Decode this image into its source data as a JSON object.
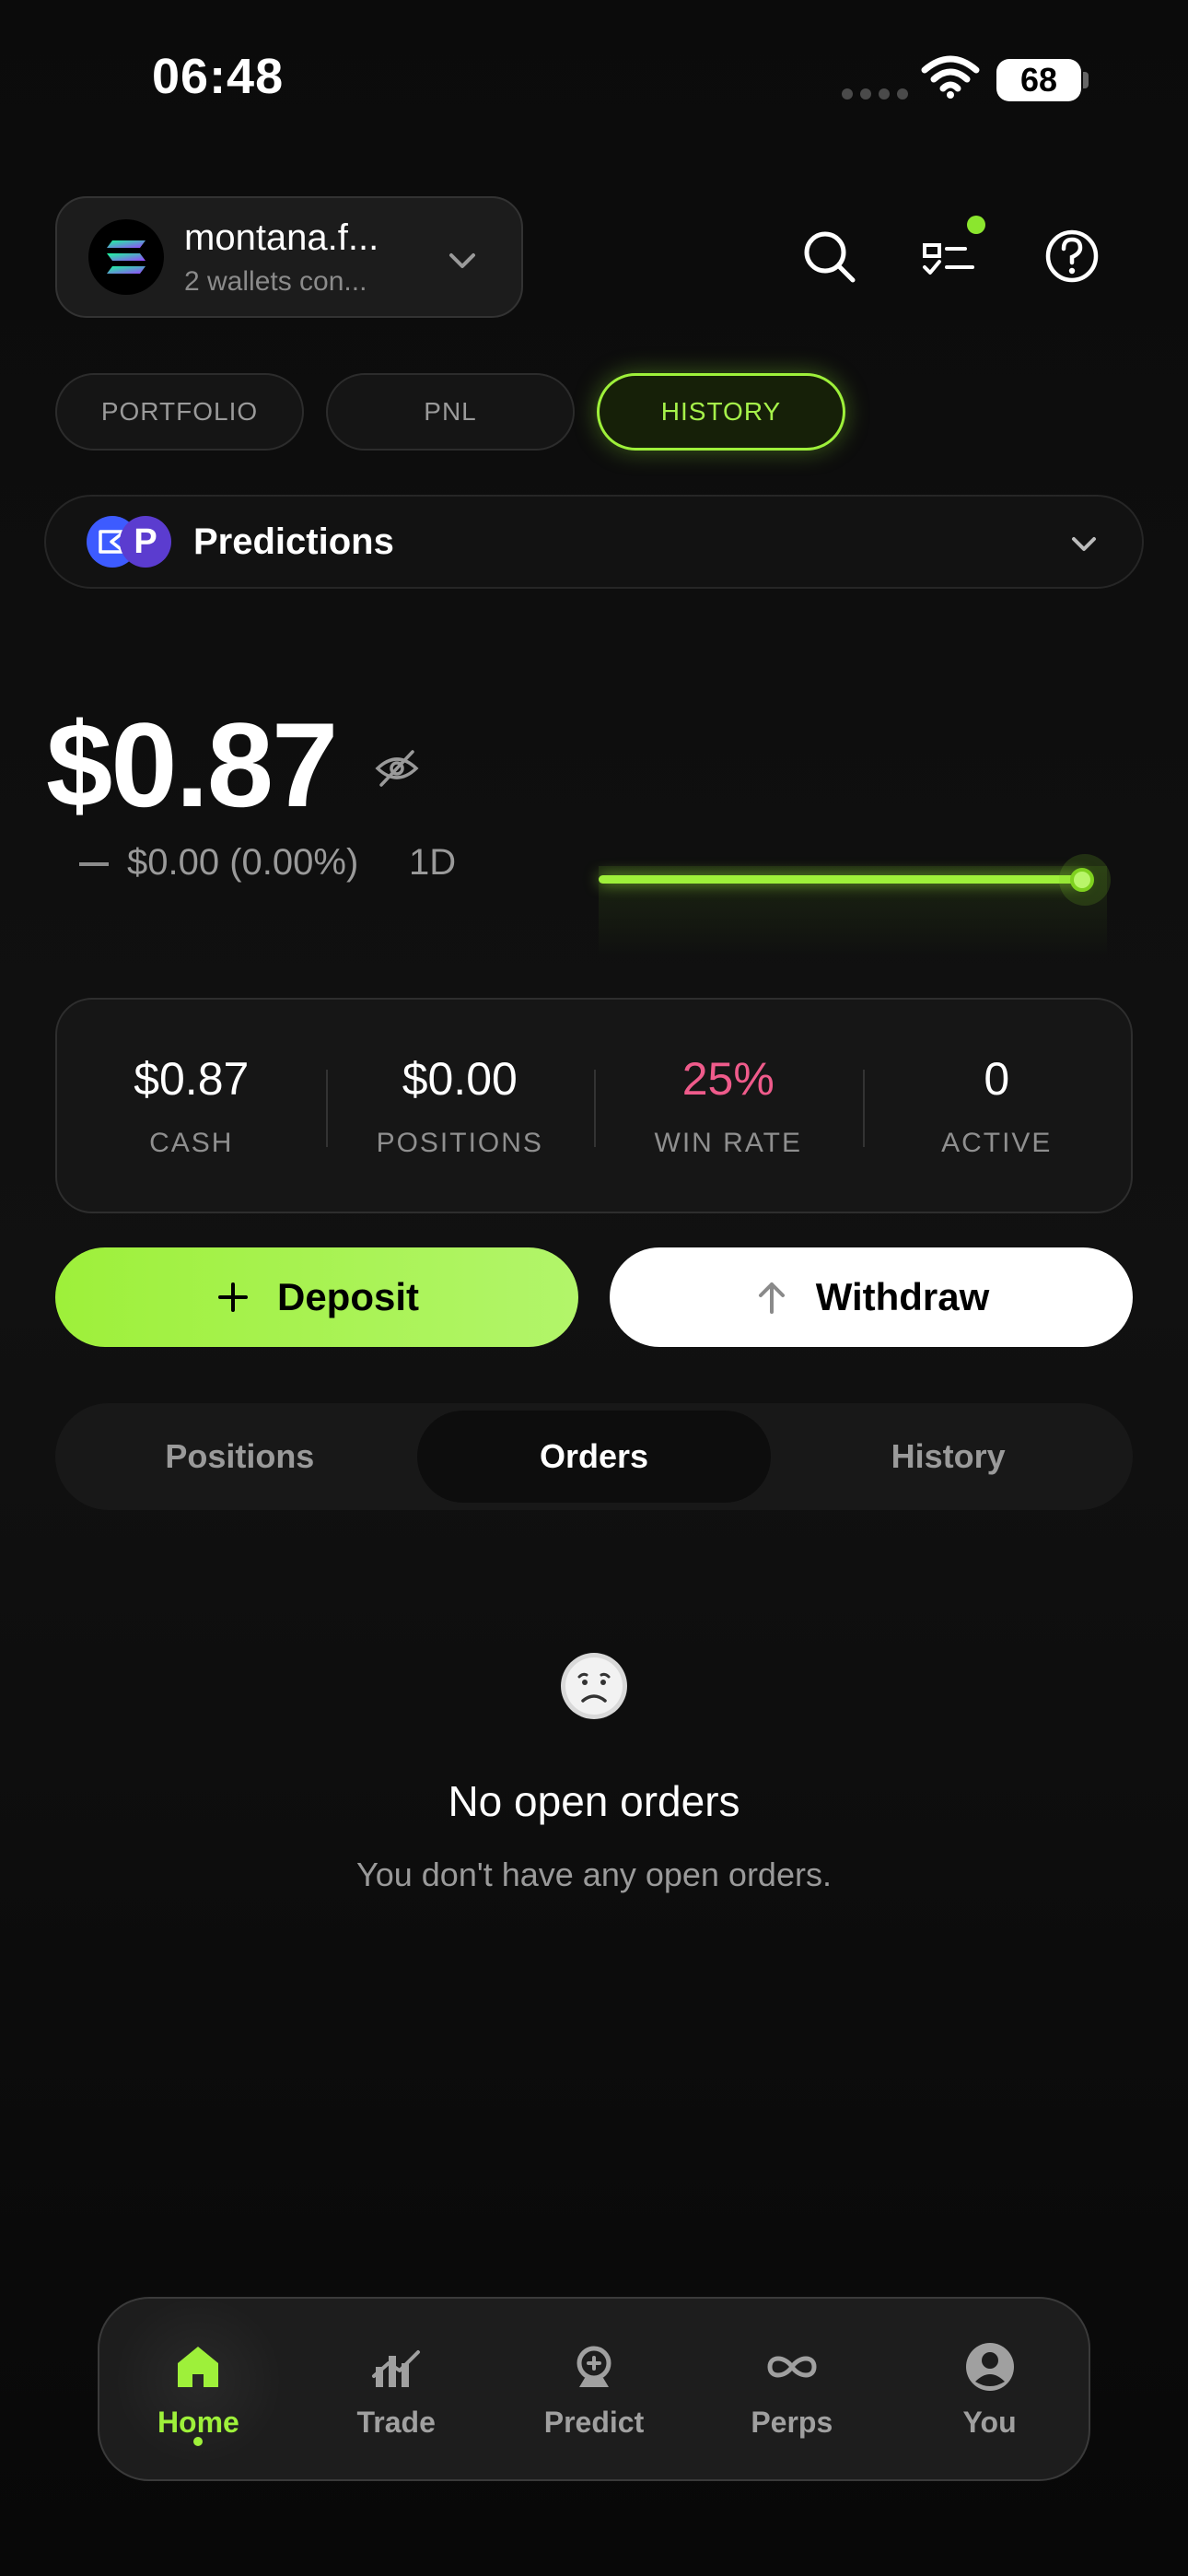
{
  "status_bar": {
    "time": "06:48",
    "battery": "68"
  },
  "account": {
    "name": "montana.f...",
    "subtitle": "2 wallets con..."
  },
  "top_tabs": [
    "PORTFOLIO",
    "PNL",
    "HISTORY"
  ],
  "top_tabs_active": "HISTORY",
  "market_selector": {
    "label": "Predictions"
  },
  "balance": {
    "value": "$0.87",
    "change": "$0.00 (0.00%)",
    "period": "1D"
  },
  "stats": [
    {
      "value": "$0.87",
      "label": "CASH"
    },
    {
      "value": "$0.00",
      "label": "POSITIONS"
    },
    {
      "value": "25%",
      "label": "WIN RATE"
    },
    {
      "value": "0",
      "label": "ACTIVE"
    }
  ],
  "actions": {
    "deposit": "Deposit",
    "withdraw": "Withdraw"
  },
  "segment_tabs": [
    "Positions",
    "Orders",
    "History"
  ],
  "segment_active": "Orders",
  "empty_state": {
    "title": "No open orders",
    "subtitle": "You don't have any open orders."
  },
  "bottom_nav": [
    {
      "label": "Home",
      "icon": "home-icon"
    },
    {
      "label": "Trade",
      "icon": "trade-chart-icon"
    },
    {
      "label": "Predict",
      "icon": "predict-icon"
    },
    {
      "label": "Perps",
      "icon": "infinity-icon"
    },
    {
      "label": "You",
      "icon": "user-icon"
    }
  ],
  "bottom_nav_active": "Home",
  "colors": {
    "accent": "#9ef03a",
    "win_rate": "#ef5b8b",
    "background": "#0a0a0a"
  }
}
